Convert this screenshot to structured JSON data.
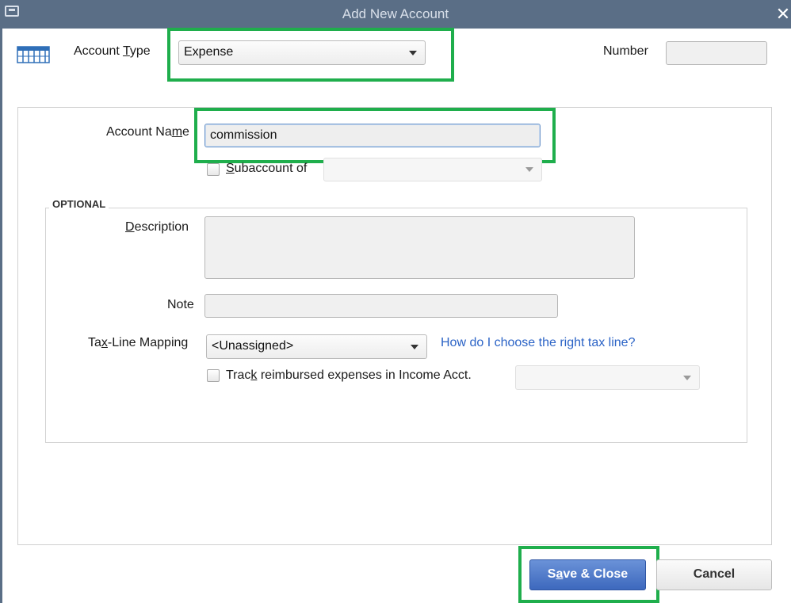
{
  "window": {
    "title": "Add New Account",
    "close_glyph": "✕"
  },
  "account_type": {
    "label_pre": "Account ",
    "label_accel": "T",
    "label_post": "ype",
    "selected": "Expense",
    "icon": "ledger-grid-icon"
  },
  "number": {
    "label": "Number",
    "value": ""
  },
  "account_name": {
    "label_pre": "Account Na",
    "label_accel": "m",
    "label_post": "e",
    "value": "commission"
  },
  "subaccount": {
    "label_accel": "S",
    "label_post": "ubaccount of",
    "checked": false,
    "selected": ""
  },
  "optional": {
    "section_label": "OPTIONAL",
    "description": {
      "label_accel": "D",
      "label_post": "escription",
      "value": ""
    },
    "note": {
      "label": "Note",
      "value": ""
    },
    "tax_line": {
      "label_pre": "Ta",
      "label_accel": "x",
      "label_post": "-Line Mapping",
      "selected": "<Unassigned>",
      "help_link": "How do I choose the right tax line?"
    },
    "track_reimbursed": {
      "label_pre": "Trac",
      "label_accel": "k",
      "label_post": " reimbursed expenses in Income Acct.",
      "checked": false,
      "selected": ""
    }
  },
  "buttons": {
    "save_close_pre": "S",
    "save_close_accel": "a",
    "save_close_post": "ve & Close",
    "cancel": "Cancel"
  },
  "colors": {
    "titlebar": "#5a6e86",
    "highlight": "#1fae4c",
    "primary_button": "#3d68bd",
    "link": "#2b63c6"
  }
}
